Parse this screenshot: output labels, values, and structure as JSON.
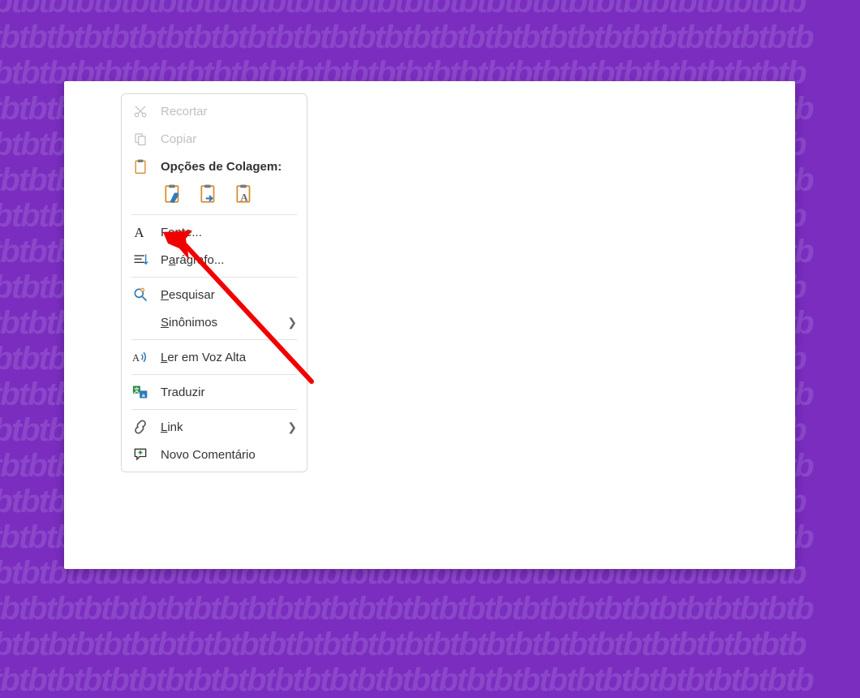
{
  "menu": {
    "cut": "Recortar",
    "copy": "Copiar",
    "pasteHeader": "Opções de Colagem:",
    "font": "Fonte...",
    "font_u": "o",
    "para": "Parágrafo...",
    "para_u": "a",
    "search": "Pesquisar",
    "search_u": "P",
    "syn": "Sinônimos",
    "syn_u": "S",
    "read": "Ler em Voz Alta",
    "read_u": "L",
    "translate": "Traduzir",
    "link": "Link",
    "link_u": "L",
    "comment": "Novo Comentário"
  }
}
